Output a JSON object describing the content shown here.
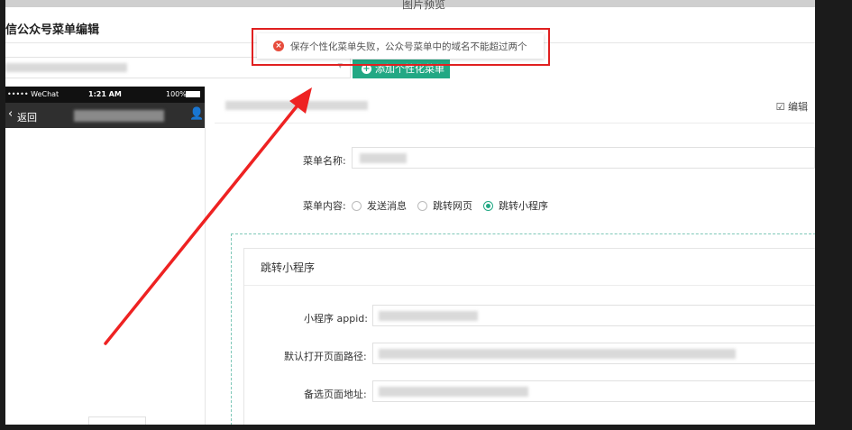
{
  "window": {
    "preview_title": "图片预览"
  },
  "page": {
    "title": "信公众号菜单编辑"
  },
  "toolbar": {
    "add_label": "添加个性化菜单"
  },
  "toast": {
    "message": "保存个性化菜单失败，公众号菜单中的域名不能超过两个"
  },
  "phone": {
    "carrier": "••••• WeChat",
    "time": "1:21 AM",
    "battery": "100%",
    "back_label": "返回"
  },
  "panel": {
    "edit_label": "编辑",
    "menu_name_label": "菜单名称:",
    "menu_content_label": "菜单内容:",
    "options": [
      "发送消息",
      "跳转网页",
      "跳转小程序"
    ],
    "selected_index": 2
  },
  "miniprogram": {
    "section_title": "跳转小程序",
    "appid_label": "小程序 appid:",
    "path_label": "默认打开页面路径:",
    "fallback_label": "备选页面地址:"
  },
  "colors": {
    "accent": "#22a884",
    "error": "#e02020",
    "arrow": "#ee2222"
  }
}
